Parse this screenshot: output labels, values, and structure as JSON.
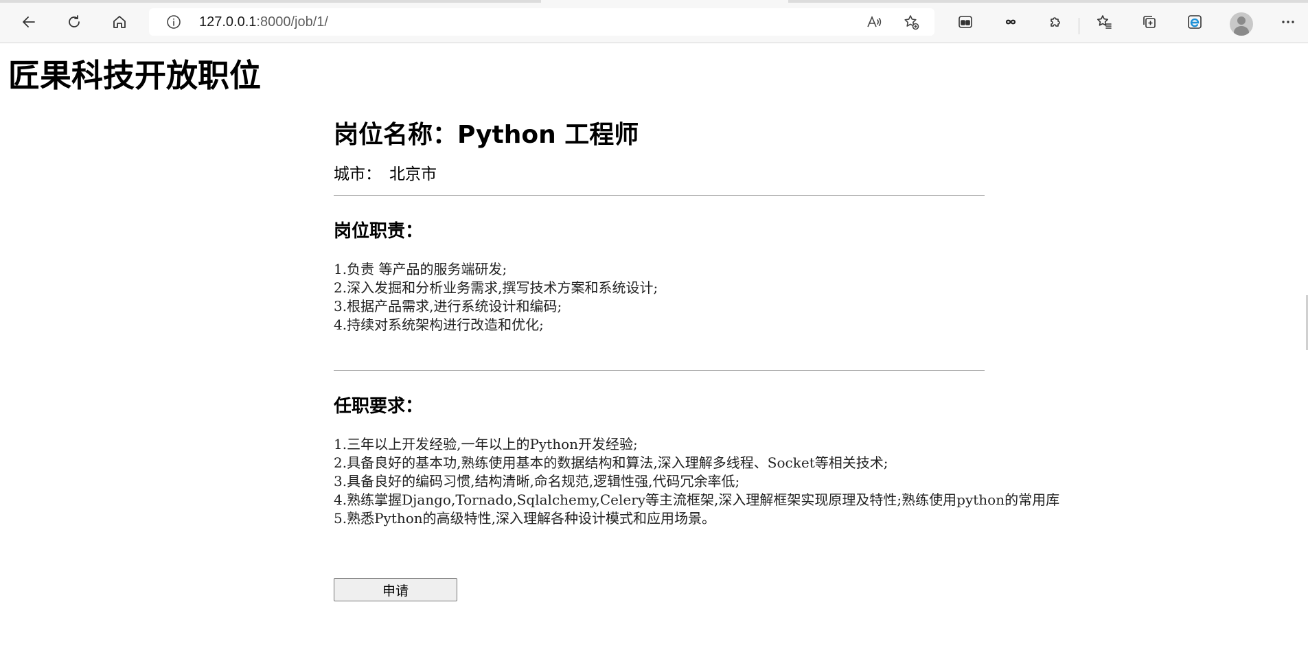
{
  "browser": {
    "url_host": "127.0.0.1",
    "url_path": ":8000/job/1/",
    "icons": {
      "back": "arrow-left-icon",
      "refresh": "refresh-icon",
      "home": "home-icon",
      "site_info": "info-icon",
      "read_aloud": "read-aloud-icon",
      "add_favorite": "star-plus-icon",
      "workspaces": "workspaces-icon",
      "infinity": "infinity-icon",
      "extensions": "puzzle-icon",
      "favorites": "favorites-icon",
      "collections": "collections-icon",
      "ie_mode": "ie-mode-icon",
      "profile": "avatar-icon",
      "more": "ellipsis-icon"
    }
  },
  "page": {
    "site_title": "匠果科技开放职位",
    "job_title": "岗位名称：Python 工程师",
    "city_label": "城市：",
    "city_value": "北京市",
    "responsibilities_heading": "岗位职责：",
    "responsibilities": [
      "1.负责 等产品的服务端研发;",
      "2.深入发掘和分析业务需求,撰写技术方案和系统设计;",
      "3.根据产品需求,进行系统设计和编码;",
      "4.持续对系统架构进行改造和优化;"
    ],
    "requirements_heading": "任职要求：",
    "requirements": [
      "1.三年以上开发经验,一年以上的Python开发经验;",
      "2.具备良好的基本功,熟练使用基本的数据结构和算法,深入理解多线程、Socket等相关技术;",
      "3.具备良好的编码习惯,结构清晰,命名规范,逻辑性强,代码冗余率低;",
      "4.熟练掌握Django,Tornado,Sqlalchemy,Celery等主流框架,深入理解框架实现原理及特性;熟练使用python的常用库",
      "5.熟悉Python的高级特性,深入理解各种设计模式和应用场景。"
    ],
    "apply_button": "申请"
  }
}
